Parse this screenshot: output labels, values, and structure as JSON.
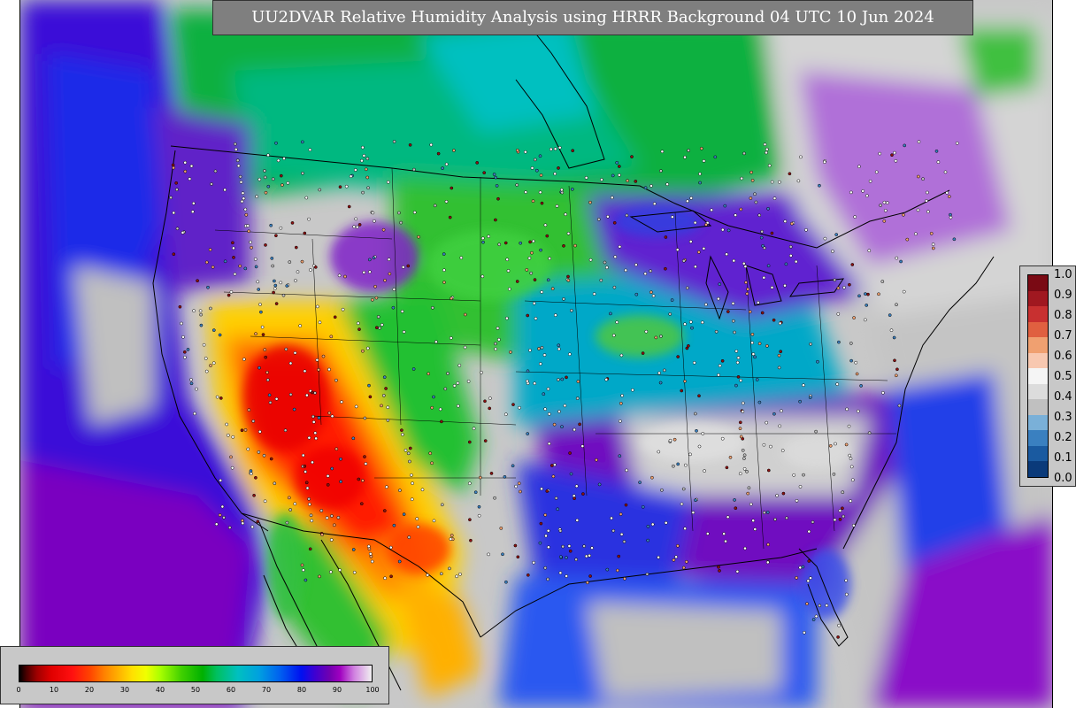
{
  "title": "UU2DVAR Relative Humidity Analysis using HRRR Background 04 UTC 10 Jun 2024",
  "rh_colorbar": {
    "ticks": [
      "0",
      "10",
      "20",
      "30",
      "40",
      "50",
      "60",
      "70",
      "80",
      "90",
      "100"
    ]
  },
  "fraction_colorbar": {
    "ticks": [
      "1.0",
      "0.9",
      "0.8",
      "0.7",
      "0.6",
      "0.5",
      "0.4",
      "0.3",
      "0.2",
      "0.1",
      "0.0"
    ],
    "colors": [
      "#7a0a14",
      "#a01820",
      "#c83030",
      "#e06040",
      "#f0a070",
      "#f8c8b0",
      "#f5f5f5",
      "#dcdcdc",
      "#c0c0c0",
      "#7ab0d8",
      "#3a80c0",
      "#1a5aa0",
      "#0a3a7a"
    ]
  },
  "colors": {
    "background": "#c8c8c8",
    "title_box": "#7f7f7f",
    "title_text": "#ffffff",
    "dry": "#ff1010",
    "moist": "#0010f0",
    "saturated": "#d0d0d0"
  }
}
